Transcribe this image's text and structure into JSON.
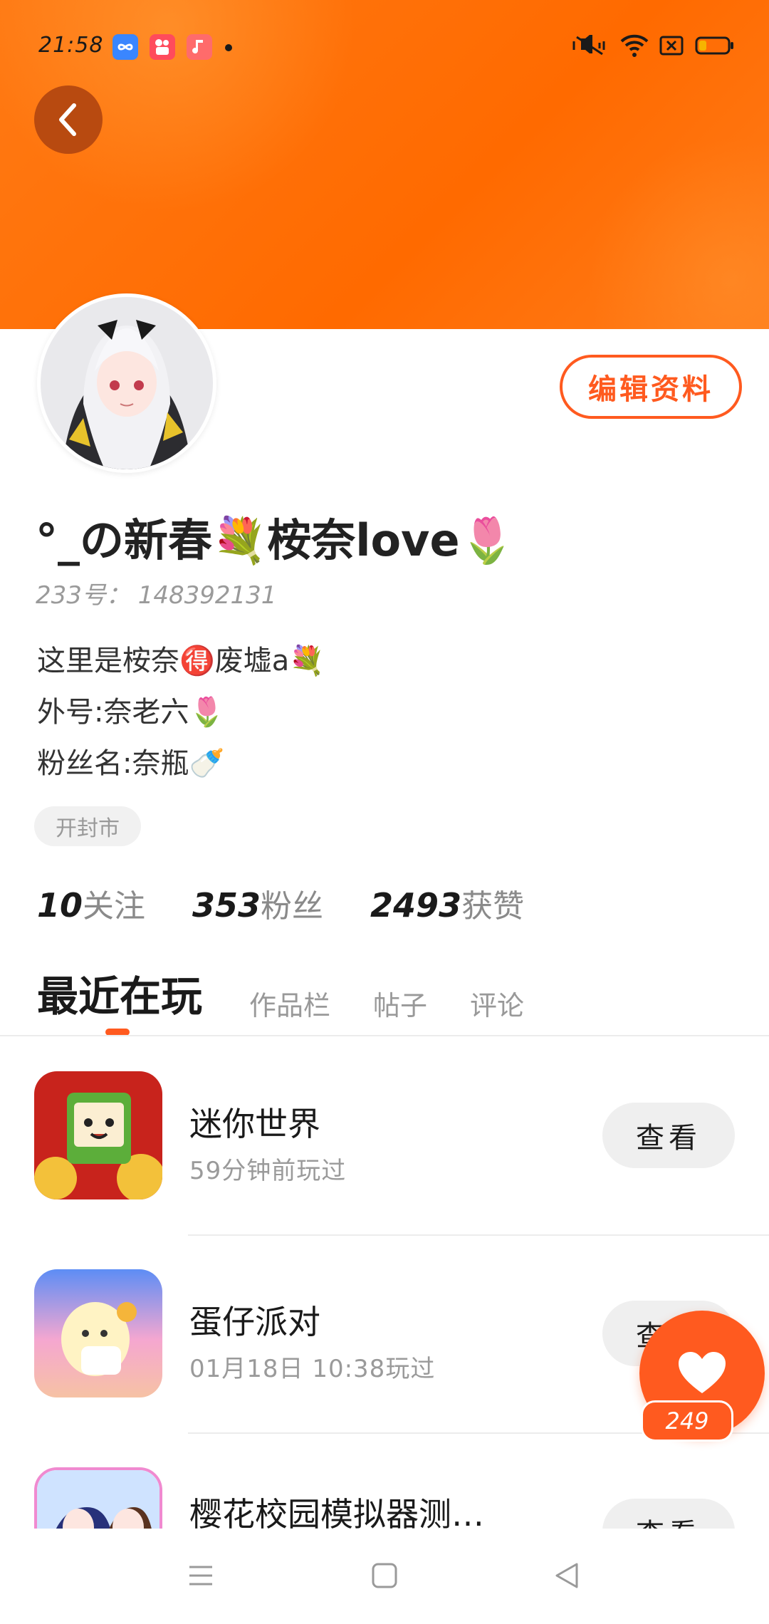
{
  "status_bar": {
    "time": "21:58",
    "app_icons": [
      "infinity-app-icon",
      "kuaishou-app-icon",
      "music-app-icon"
    ],
    "system_icons": [
      "mute-icon",
      "wifi-icon",
      "sim-icon",
      "battery-icon"
    ]
  },
  "header": {
    "back_icon": "chevron-left-icon",
    "banner_color": "#ff6a00"
  },
  "profile": {
    "edit_label": "编辑资料",
    "nickname": "°_の新春💐桉奈love🌷",
    "uid": "233号： 148392131",
    "bio": [
      "这里是桉奈🉐废墟a💐",
      "外号:奈老六🌷",
      "粉丝名:奈瓶🍼"
    ],
    "location": "开封市"
  },
  "stats": [
    {
      "num": "10",
      "label": "关注"
    },
    {
      "num": "353",
      "label": "粉丝"
    },
    {
      "num": "2493",
      "label": "获赞"
    }
  ],
  "tabs": [
    {
      "label": "最近在玩",
      "active": true
    },
    {
      "label": "作品栏",
      "active": false
    },
    {
      "label": "帖子",
      "active": false
    },
    {
      "label": "评论",
      "active": false
    }
  ],
  "games": [
    {
      "name": "迷你世界",
      "played": "59分钟前玩过",
      "button": "查看"
    },
    {
      "name": "蛋仔派对",
      "played": "01月18日 10:38玩过",
      "button": "查看"
    },
    {
      "name": "樱花校园模拟器测…",
      "played": "",
      "button": "查看"
    }
  ],
  "like_button": {
    "count": "249",
    "icon": "heart-icon"
  },
  "nav": {
    "icons": [
      "menu-icon",
      "home-icon",
      "back-icon"
    ]
  },
  "accent": "#ff5a1f"
}
